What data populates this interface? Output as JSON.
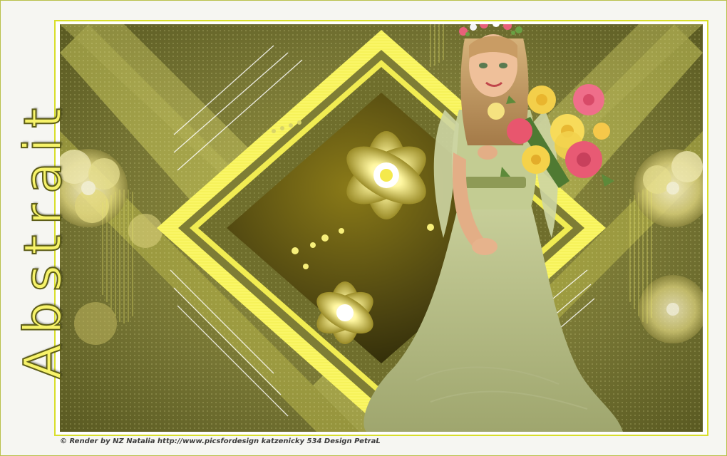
{
  "title": "Abstrait",
  "credit": "© Render by NZ Natalia http://www.picsfordesign katzenicky 534 Design PetraL",
  "colors": {
    "accent": "#f5f04a",
    "olive_dark": "#5a5a22",
    "olive_mid": "#8a8a3a",
    "olive_light": "#c7c67a",
    "frame_yellow": "#d8de2a",
    "dress": "#c9d3a0",
    "skin": "#e8b48e",
    "hair": "#c9a06a"
  },
  "scene": {
    "background": "olive-yellow abstract diamond pattern",
    "center": "yellow framed diamond with fractal flowers",
    "figure": "seated girl in pale green dress holding flower bouquet"
  }
}
